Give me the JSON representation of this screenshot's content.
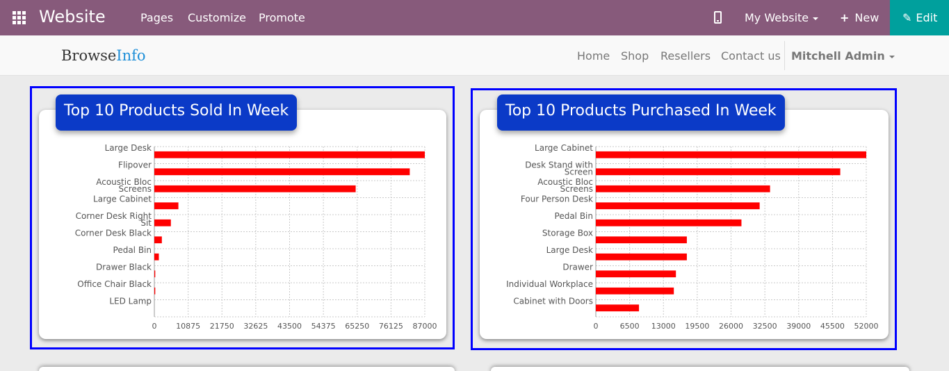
{
  "topbar": {
    "app_name": "Website",
    "menu": [
      "Pages",
      "Customize",
      "Promote"
    ],
    "site_selector": "My Website",
    "new_label": "New",
    "edit_label": "Edit"
  },
  "site": {
    "logo_part1": "Browse",
    "logo_part2": "Info",
    "nav": [
      "Home",
      "Shop",
      "Resellers",
      "Contact us"
    ],
    "user": "Mitchell Admin"
  },
  "colors": {
    "topbar": "#875a7b",
    "edit_button": "#00a09d",
    "badge": "#0b3ac7",
    "bar": "#ff0000",
    "outline": "#0000ff"
  },
  "chart_data": [
    {
      "type": "bar",
      "orientation": "horizontal",
      "title": "Top 10 Products Sold In Week",
      "categories": [
        "Large Desk",
        "Flipover",
        "Acoustic Bloc Screens",
        "Large Cabinet",
        "Corner Desk Right Sit",
        "Corner Desk Black",
        "Pedal Bin",
        "Drawer Black",
        "Office Chair Black",
        "LED Lamp"
      ],
      "values": [
        90000,
        85000,
        67000,
        8000,
        5500,
        2500,
        1500,
        300,
        300,
        0
      ],
      "ticks": [
        "0",
        "10875",
        "21750",
        "32625",
        "43500",
        "54375",
        "65250",
        "76125",
        "87000"
      ],
      "xlim": [
        0,
        90000
      ],
      "grid": true,
      "legend": "none"
    },
    {
      "type": "bar",
      "orientation": "horizontal",
      "title": "Top 10 Products Purchased In Week",
      "categories": [
        "Large Cabinet",
        "Desk Stand with Screen",
        "Acoustic Bloc Screens",
        "Four Person Desk",
        "Pedal Bin",
        "Storage Box",
        "Large Desk",
        "Drawer",
        "Individual Workplace",
        "Cabinet with Doors"
      ],
      "values": [
        52000,
        47000,
        33500,
        31500,
        28000,
        17500,
        17500,
        15400,
        15000,
        8300
      ],
      "ticks": [
        "0",
        "6500",
        "13000",
        "19500",
        "26000",
        "32500",
        "39000",
        "45500",
        "52000"
      ],
      "xlim": [
        0,
        52000
      ],
      "grid": true,
      "legend": "none"
    }
  ]
}
